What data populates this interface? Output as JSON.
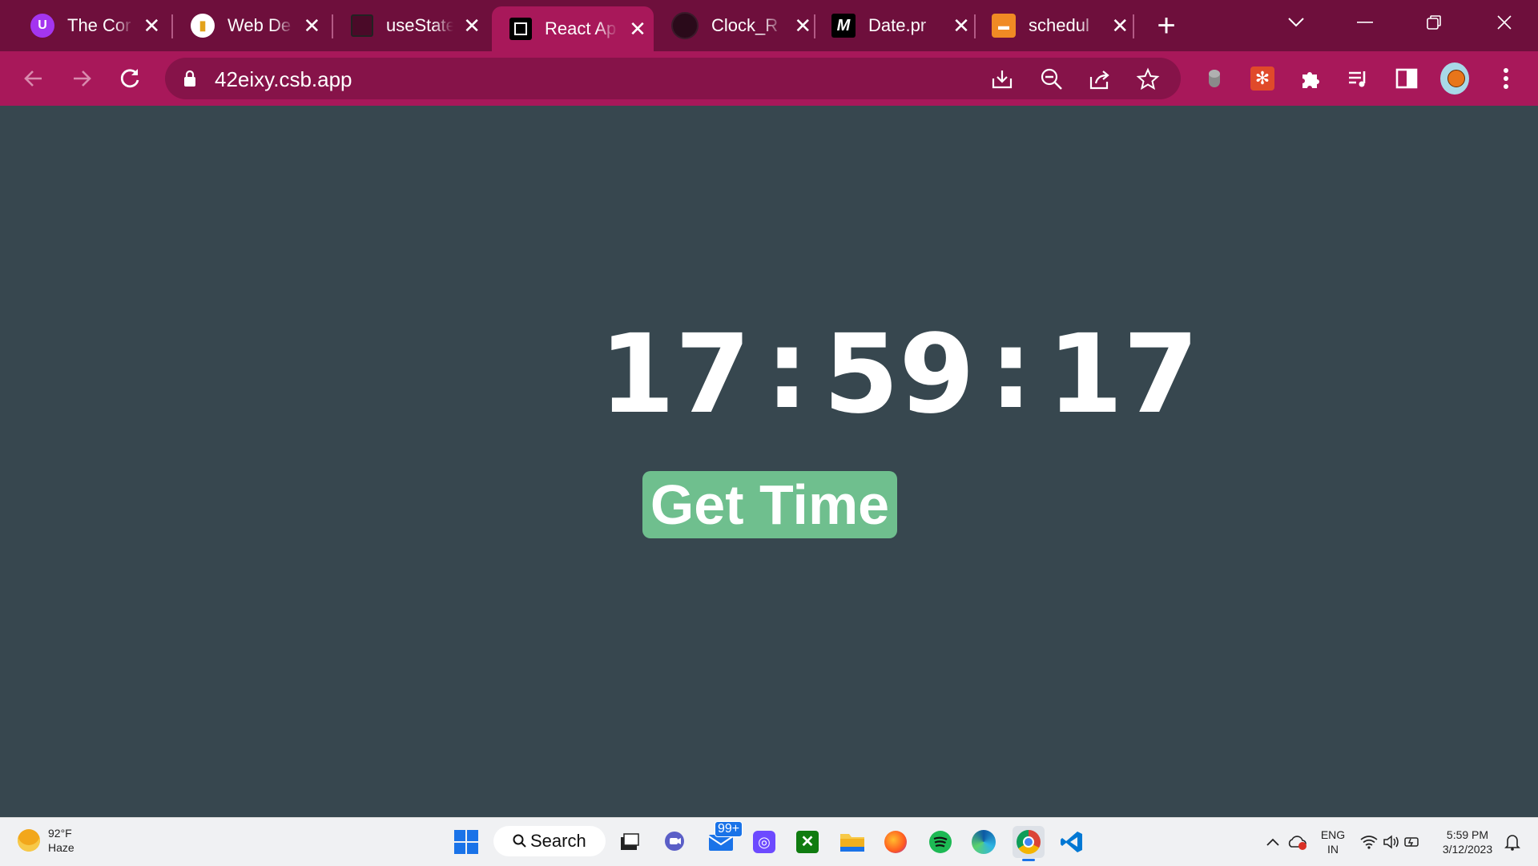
{
  "browser": {
    "tabs": [
      {
        "title": "The Cor",
        "icon": "udemy-icon"
      },
      {
        "title": "Web De",
        "icon": "web-dev-icon"
      },
      {
        "title": "useState",
        "icon": "react-doc-icon"
      },
      {
        "title": "React Ap",
        "icon": "codesandbox-icon"
      },
      {
        "title": "Clock_R",
        "icon": "github-icon"
      },
      {
        "title": "Date.pr",
        "icon": "mdn-icon"
      },
      {
        "title": "schedul",
        "icon": "scheduler-icon"
      }
    ],
    "active_tab_index": 3,
    "address": "42eixy.csb.app",
    "accent_color": "#a8185a",
    "tabstrip_color": "#6e0f3c"
  },
  "app": {
    "hours": "17",
    "minutes": "59",
    "seconds": "17",
    "separator": ":",
    "button_label": "Get Time",
    "background_color": "#37474f",
    "button_color": "#6fbf8e"
  },
  "taskbar": {
    "weather": {
      "temp": "92°F",
      "condition": "Haze"
    },
    "search_label": "Search",
    "mail_badge": "99+",
    "language": {
      "line1": "ENG",
      "line2": "IN"
    },
    "clock": {
      "time": "5:59 PM",
      "date": "3/12/2023"
    }
  }
}
